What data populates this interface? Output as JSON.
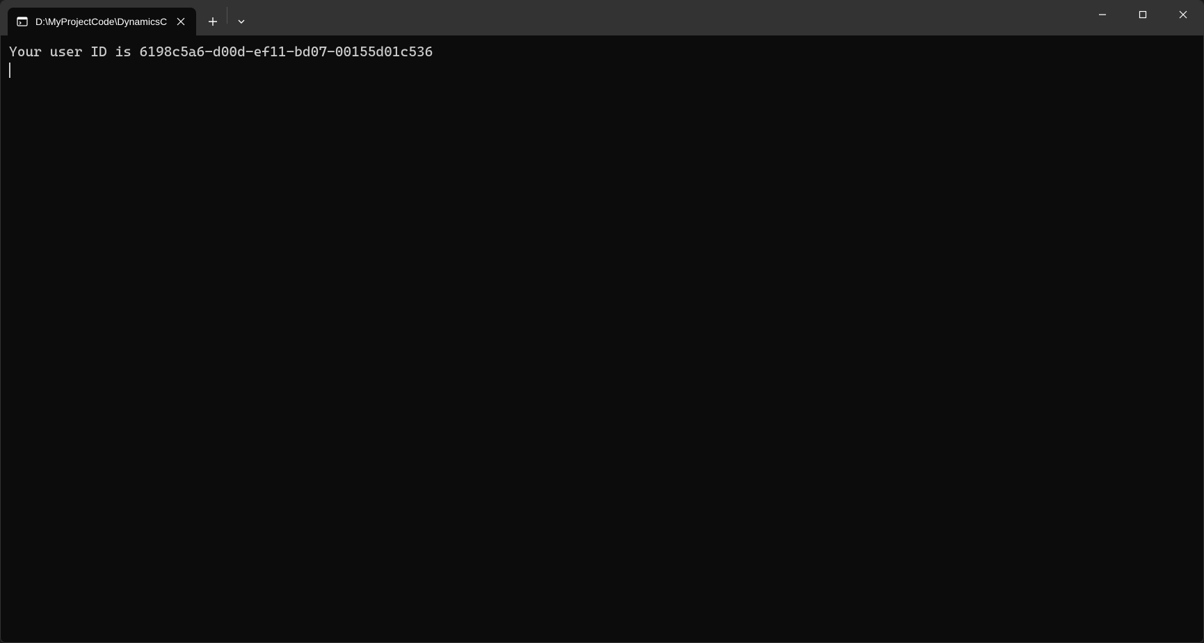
{
  "tab": {
    "title": "D:\\MyProjectCode\\DynamicsC",
    "icon": "terminal-icon"
  },
  "terminal": {
    "output_line": "Your user ID is 6198c5a6-d00d-ef11-bd07-00155d01c536"
  },
  "colors": {
    "titlebar": "#333333",
    "terminal_bg": "#0c0c0c",
    "terminal_fg": "#cccccc",
    "tab_active_bg": "#0c0c0c"
  }
}
